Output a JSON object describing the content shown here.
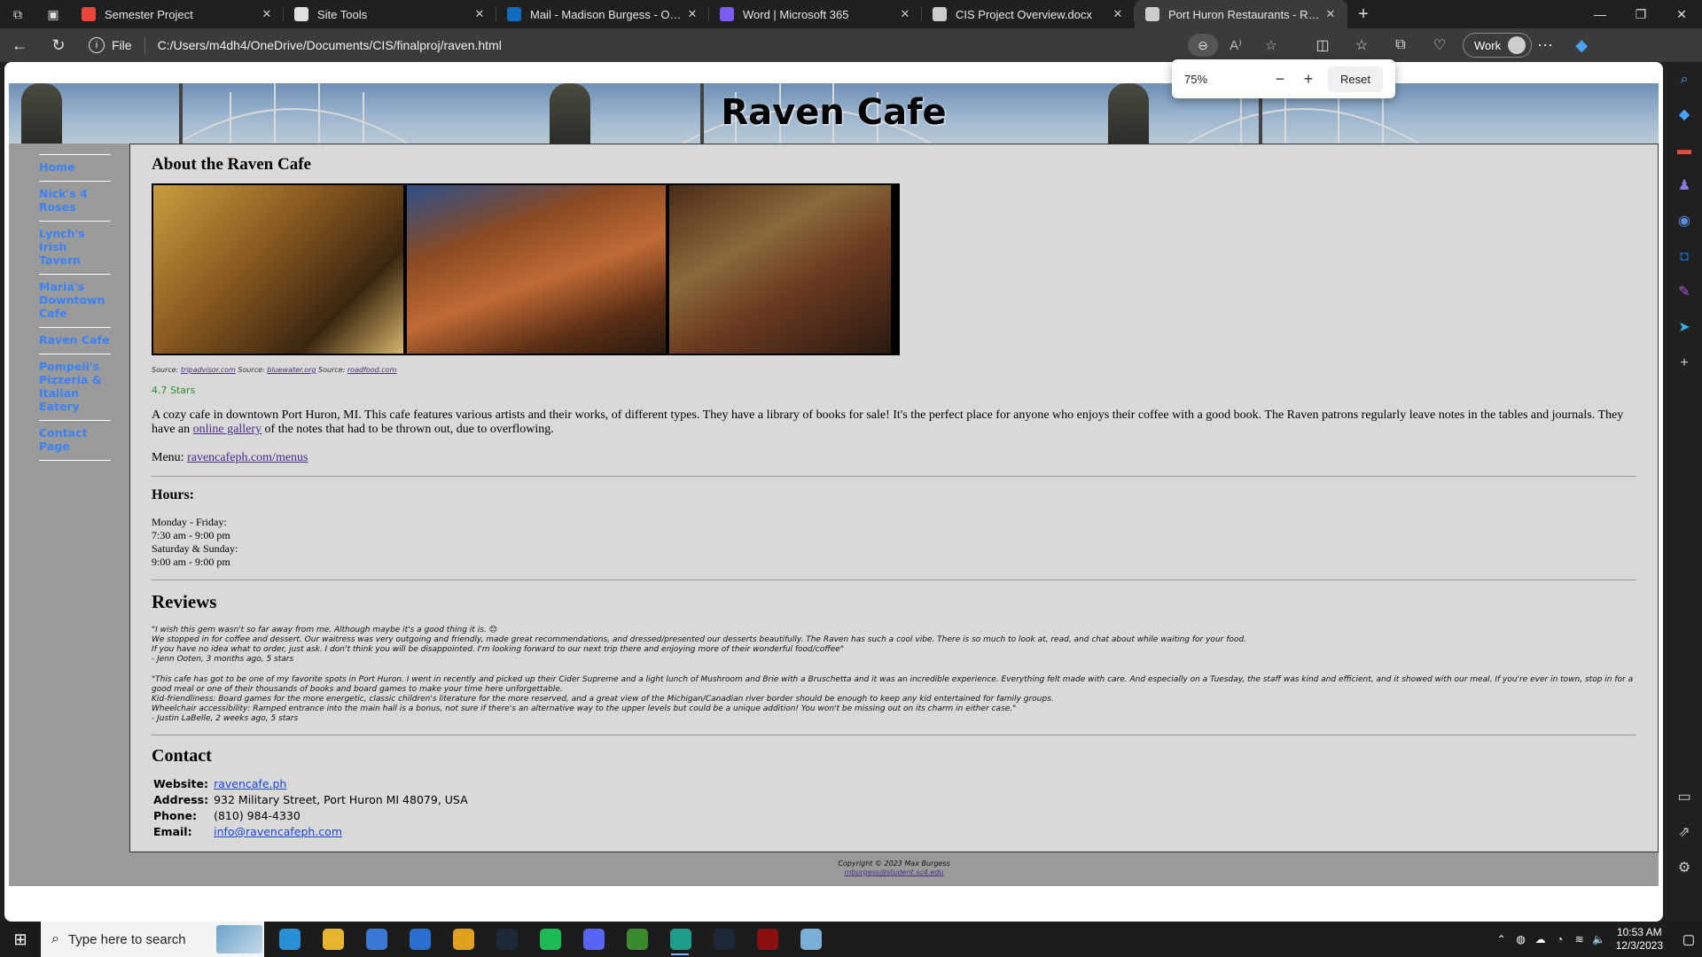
{
  "browser": {
    "tabs": [
      {
        "title": "Semester Project",
        "icon": "red-circle-icon",
        "color": "#e8453c"
      },
      {
        "title": "Site Tools",
        "icon": "s-logo-icon",
        "color": "#e0e0e0"
      },
      {
        "title": "Mail - Madison Burgess - Outlook",
        "icon": "outlook-icon",
        "color": "#0f6cbd"
      },
      {
        "title": "Word | Microsoft 365",
        "icon": "m365-icon",
        "color": "#7a5cf0"
      },
      {
        "title": "CIS Project Overview.docx",
        "icon": "document-icon",
        "color": "#cccccc"
      },
      {
        "title": "Port Huron Restaurants - Raven Cafe",
        "icon": "document-icon",
        "color": "#cccccc",
        "active": true
      }
    ],
    "address": {
      "scheme": "File",
      "url": "C:/Users/m4dh4/OneDrive/Documents/CIS/finalproj/raven.html"
    },
    "profile_label": "Work",
    "zoom_popup": {
      "value": "75%",
      "reset_label": "Reset"
    }
  },
  "page": {
    "site_title": "Raven Cafe",
    "nav": [
      {
        "label": "Home"
      },
      {
        "label": "Nick's 4 Roses"
      },
      {
        "label": "Lynch's Irish Tavern"
      },
      {
        "label": "Maria's Downtown Cafe"
      },
      {
        "label": "Raven Cafe"
      },
      {
        "label": "Pompeii's Pizzeria & Italian Eatery"
      },
      {
        "label": "Contact Page"
      }
    ],
    "about": {
      "heading": "About the Raven Cafe",
      "photos": [
        "cafe-interior-photo",
        "cafe-storefront-photo",
        "cafe-bookshelves-photo"
      ],
      "source_prefix": "Source:",
      "sources": [
        "tripadvisor.com",
        "bluewater.org",
        "roadfood.com"
      ],
      "rating": "4.7 Stars",
      "description_before": "A cozy cafe in downtown Port Huron, MI. This cafe features various artists and their works, of different types. They have a library of books for sale! It's the perfect place for anyone who enjoys their coffee with a good book. The Raven patrons regularly leave notes in the tables and journals. They have an ",
      "description_link": "online gallery",
      "description_after": " of the notes that had to be thrown out, due to overflowing.",
      "menu_label": "Menu:",
      "menu_link": "ravencafeph.com/menus"
    },
    "hours": {
      "heading": "Hours:",
      "lines": [
        "Monday - Friday:",
        "7:30 am - 9:00 pm",
        "Saturday & Sunday:",
        "9:00 am - 9:00 pm"
      ]
    },
    "reviews": {
      "heading": "Reviews",
      "items": [
        {
          "lines": [
            "\"I wish this gem wasn't so far away from me. Although maybe it's a good thing it is. 😊",
            "We stopped in for coffee and dessert. Our waitress was very outgoing and friendly, made great recommendations, and dressed/presented our desserts beautifully. The Raven has such a cool vibe. There is so much to look at, read, and chat about while waiting for your food.",
            "If you have no idea what to order, just ask. I don't think you will be disappointed. I'm looking forward to our next trip there and enjoying more of their wonderful food/coffee\"",
            "- Jenn Ooten, 3 months ago, 5 stars"
          ]
        },
        {
          "lines": [
            "\"This cafe has got to be one of my favorite spots in Port Huron. I went in recently and picked up their Cider Supreme and a light lunch of Mushroom and Brie with a Bruschetta and it was an incredible experience. Everything felt made with care. And especially on a Tuesday, the staff was kind and efficient, and it showed with our meal. If you're ever in town, stop in for a good meal or one of their thousands of books and board games to make your time here unforgettable.",
            "Kid-friendliness: Board games for the more energetic, classic children's literature for the more reserved, and a great view of the Michigan/Canadian river border should be enough to keep any kid entertained for family groups.",
            "Wheelchair accessibility: Ramped entrance into the main hall is a bonus, not sure if there's an alternative way to the upper levels but could be a unique addition! You won't be missing out on its charm in either case.\"",
            "- Justin LaBelle, 2 weeks ago, 5 stars"
          ]
        }
      ]
    },
    "contact": {
      "heading": "Contact",
      "rows": [
        {
          "key": "Website:",
          "value": "ravencafe.ph",
          "link": true
        },
        {
          "key": "Address:",
          "value": "932 Military Street, Port Huron MI 48079, USA",
          "link": false
        },
        {
          "key": "Phone:",
          "value": "(810) 984-4330",
          "link": false
        },
        {
          "key": "Email:",
          "value": "info@ravencafeph.com",
          "link": true
        }
      ]
    },
    "footer": {
      "copyright": "Copyright © 2023 Max Burgess",
      "email": "mburgess@student.sc4.edu"
    }
  },
  "taskbar": {
    "search_placeholder": "Type here to search",
    "apps": [
      "edge-icon",
      "file-explorer-icon",
      "store-icon",
      "mail-icon",
      "chrome-icon",
      "steam-icon",
      "spotify-icon",
      "discord-icon",
      "minecraft-icon",
      "edge-dev-icon",
      "steam-icon",
      "game-icon",
      "notepad-icon"
    ],
    "time": "10:53 AM",
    "date": "12/3/2023"
  },
  "colors": {
    "nav_link": "#3b82f6",
    "content_bg": "#d9d9d9",
    "page_gray": "#9a9a9a",
    "rating_green": "#2e8b2e",
    "link_purple": "#4b2a8a"
  }
}
